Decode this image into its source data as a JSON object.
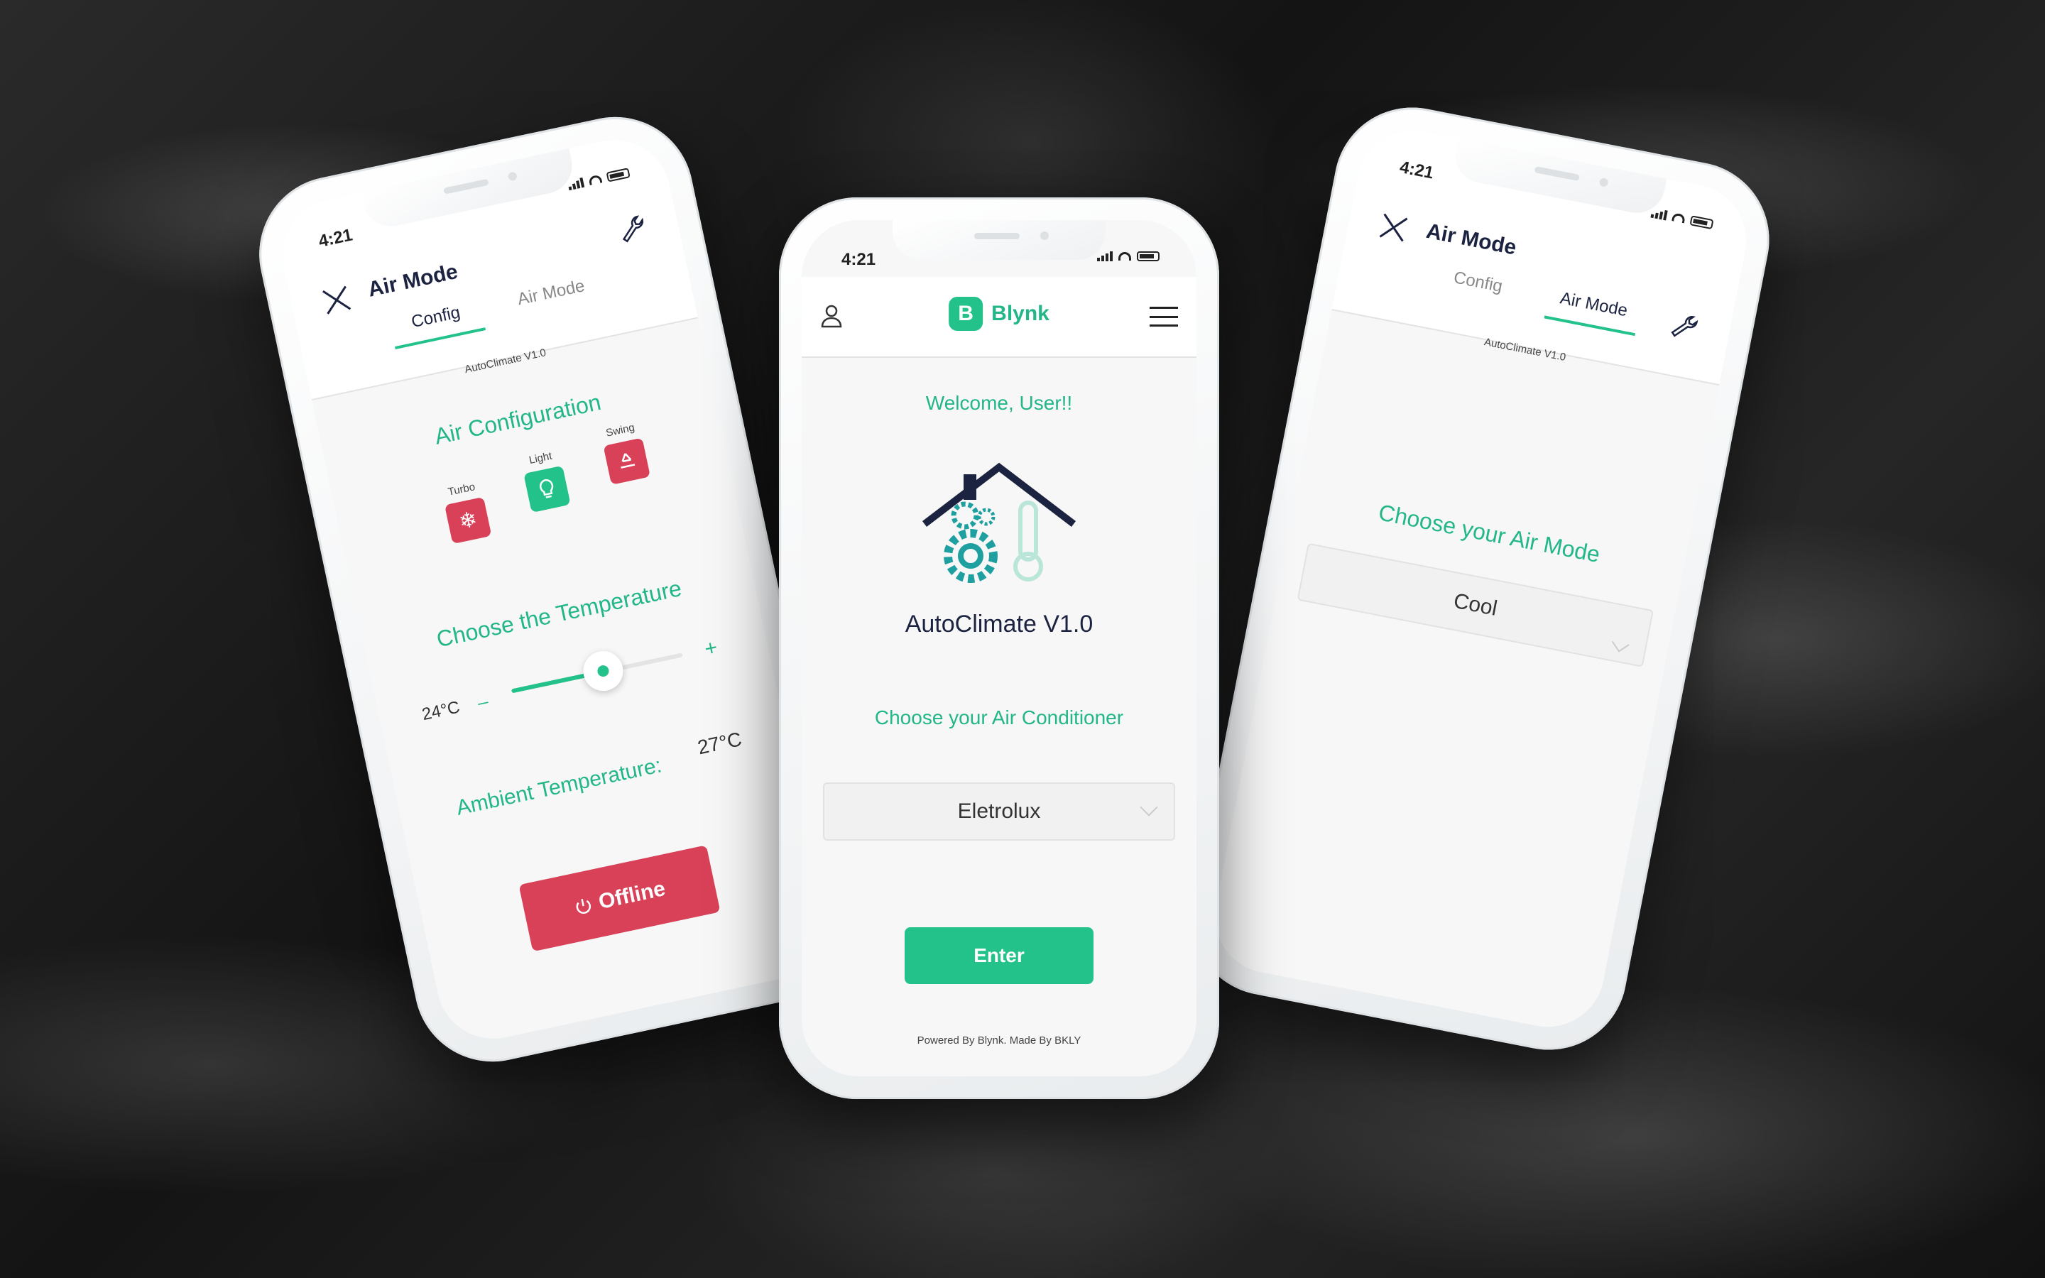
{
  "status": {
    "time": "4:21"
  },
  "center": {
    "brand": {
      "letter": "B",
      "name": "Blynk"
    },
    "welcome": "Welcome, User!!",
    "app_name": "AutoClimate V1.0",
    "choose_label": "Choose your Air Conditioner",
    "dropdown_value": "Eletrolux",
    "enter_label": "Enter",
    "footer": "Powered By Blynk. Made By BKLY"
  },
  "left": {
    "header_title": "Air Mode",
    "tabs": [
      {
        "label": "Config"
      },
      {
        "label": "Air Mode"
      }
    ],
    "subtitle": "AutoClimate V1.0",
    "air_config_title": "Air Configuration",
    "options": [
      {
        "label": "Turbo",
        "icon": "snowflake-icon",
        "color": "#d94158"
      },
      {
        "label": "Light",
        "icon": "bulb-icon",
        "color": "#22c28a"
      },
      {
        "label": "Swing",
        "icon": "recycle-icon",
        "color": "#d94158"
      }
    ],
    "temp_title": "Choose the Temperature",
    "temp_value": "24°C",
    "slider_level": 0.55,
    "minus": "–",
    "plus": "+",
    "ambient_label": "Ambient Temperature:",
    "ambient_value": "27°C",
    "offline_label": "Offline"
  },
  "right": {
    "header_title": "Air Mode",
    "tabs": [
      {
        "label": "Config"
      },
      {
        "label": "Air Mode"
      }
    ],
    "subtitle": "AutoClimate V1.0",
    "choose_label": "Choose your Air Mode",
    "dropdown_value": "Cool"
  },
  "colors": {
    "accent": "#22c28a",
    "danger": "#d94158",
    "navy": "#1c2340"
  }
}
